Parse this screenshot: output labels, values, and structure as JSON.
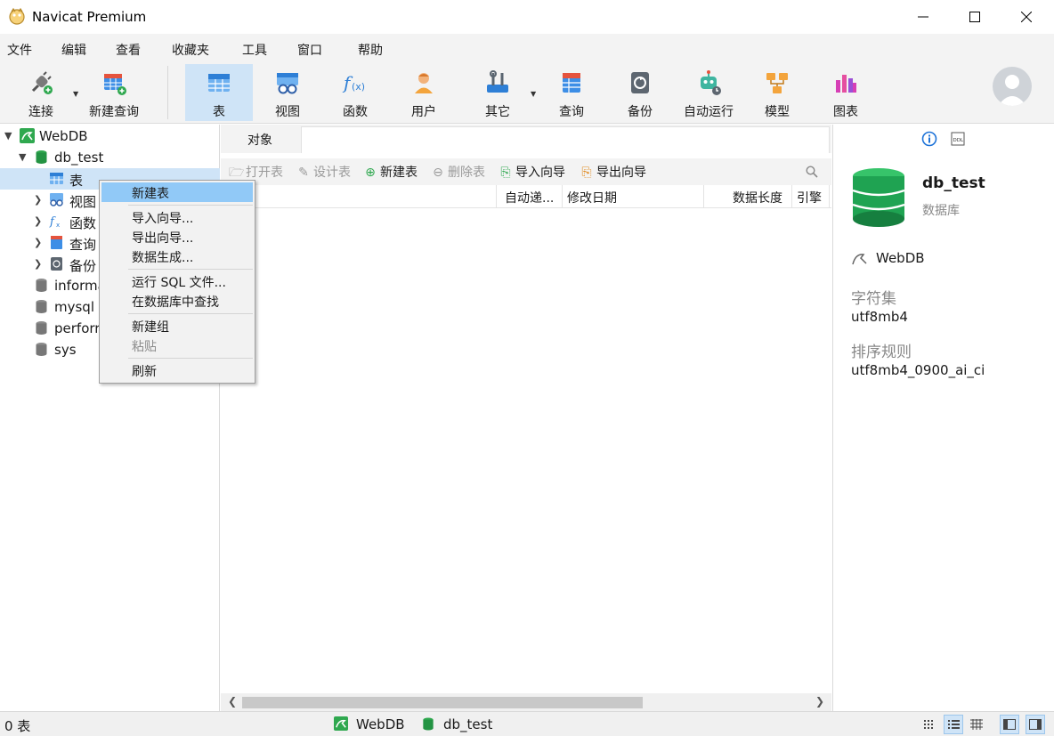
{
  "window": {
    "title": "Navicat Premium"
  },
  "menubar": [
    "文件",
    "编辑",
    "查看",
    "收藏夹",
    "工具",
    "窗口",
    "帮助"
  ],
  "toolbar": {
    "connect": "连接",
    "new_query": "新建查询",
    "table": "表",
    "view": "视图",
    "function": "函数",
    "user": "用户",
    "other": "其它",
    "query": "查询",
    "backup": "备份",
    "automation": "自动运行",
    "model": "模型",
    "chart": "图表"
  },
  "tree": {
    "connection": "WebDB",
    "database": "db_test",
    "children": [
      "表",
      "视图",
      "函数",
      "查询",
      "备份"
    ],
    "other_dbs": [
      "informa",
      "mysql",
      "perforr",
      "sys"
    ]
  },
  "center": {
    "tab": "对象",
    "actions": {
      "open_table": "打开表",
      "design_table": "设计表",
      "new_table": "新建表",
      "delete_table": "删除表",
      "import_wizard": "导入向导",
      "export_wizard": "导出向导"
    },
    "columns": [
      "自动递...",
      "修改日期",
      "数据长度",
      "引擎"
    ]
  },
  "context_menu": {
    "new_table": "新建表",
    "import_wizard": "导入向导...",
    "export_wizard": "导出向导...",
    "data_generation": "数据生成...",
    "run_sql": "运行 SQL 文件...",
    "find_in_db": "在数据库中查找",
    "new_group": "新建组",
    "paste": "粘贴",
    "refresh": "刷新"
  },
  "info_panel": {
    "name": "db_test",
    "type": "数据库",
    "connection": "WebDB",
    "charset_label": "字符集",
    "charset_value": "utf8mb4",
    "collation_label": "排序规则",
    "collation_value": "utf8mb4_0900_ai_ci"
  },
  "statusbar": {
    "count": "0 表",
    "connection": "WebDB",
    "database": "db_test"
  }
}
